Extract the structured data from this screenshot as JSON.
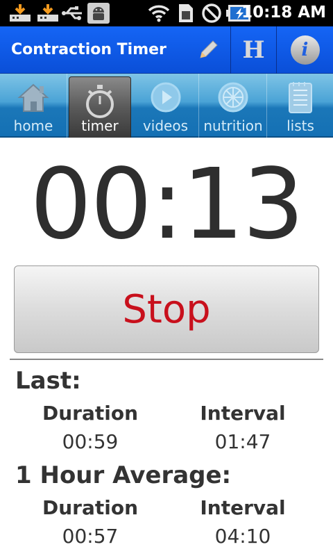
{
  "status_bar": {
    "time": "10:18 AM",
    "icons": [
      "download-icon",
      "download-icon",
      "usb-icon",
      "android-debug-icon",
      "wifi-icon",
      "sim-icon",
      "no-signal-icon",
      "battery-charging-icon"
    ]
  },
  "app": {
    "title": "Contraction Timer",
    "actions": {
      "edit_icon": "pencil-icon",
      "help_letter": "H",
      "info_letter": "i"
    }
  },
  "tabs": [
    {
      "label": "home",
      "icon": "house-icon",
      "active": false
    },
    {
      "label": "timer",
      "icon": "stopwatch-icon",
      "active": true
    },
    {
      "label": "videos",
      "icon": "play-icon",
      "active": false
    },
    {
      "label": "nutrition",
      "icon": "fruit-icon",
      "active": false
    },
    {
      "label": "lists",
      "icon": "notepad-icon",
      "active": false
    }
  ],
  "timer": {
    "display": "00:13"
  },
  "stop_button": {
    "label": "Stop"
  },
  "last": {
    "heading": "Last:",
    "duration_label": "Duration",
    "duration_value": "00:59",
    "interval_label": "Interval",
    "interval_value": "01:47"
  },
  "average": {
    "heading": "1 Hour Average:",
    "duration_label": "Duration",
    "duration_value": "00:57",
    "interval_label": "Interval",
    "interval_value": "04:10"
  },
  "colors": {
    "title_bar": "#1565f5",
    "stop_text": "#c8101c",
    "tab_bar": "#1b77b8"
  }
}
